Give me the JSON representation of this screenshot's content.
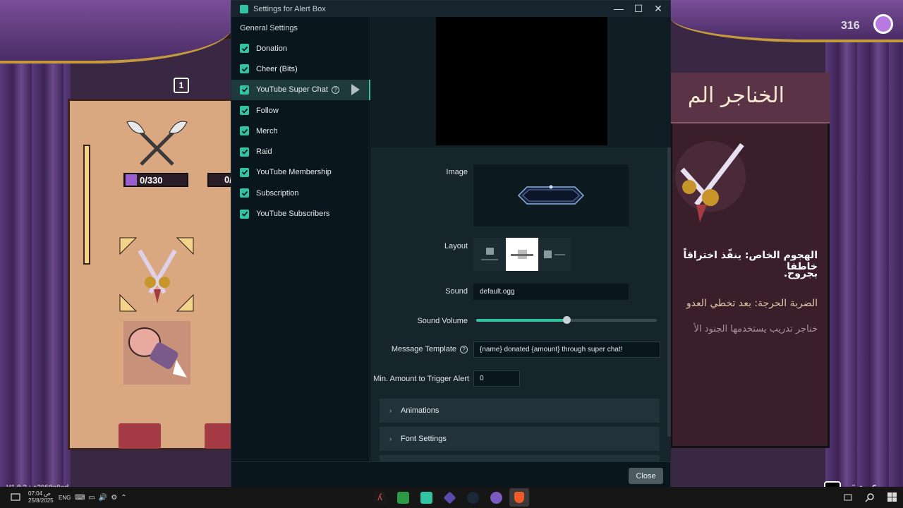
{
  "window": {
    "title": "Settings for Alert Box",
    "controls": [
      "—",
      "☐",
      "✕"
    ]
  },
  "sidebar": {
    "heading": "General Settings",
    "items": [
      {
        "label": "Donation",
        "checked": true
      },
      {
        "label": "Cheer (Bits)",
        "checked": true
      },
      {
        "label": "YouTube Super Chat",
        "checked": true,
        "active": true
      },
      {
        "label": "Follow",
        "checked": true
      },
      {
        "label": "Merch",
        "checked": true
      },
      {
        "label": "Raid",
        "checked": true
      },
      {
        "label": "YouTube Membership",
        "checked": true
      },
      {
        "label": "Subscription",
        "checked": true
      },
      {
        "label": "YouTube Subscribers",
        "checked": true
      }
    ]
  },
  "settings": {
    "image_label": "Image",
    "layout_label": "Layout",
    "sound_label": "Sound",
    "sound_value": "default.ogg",
    "volume_label": "Sound Volume",
    "volume_value": 0.5,
    "message_template_label": "Message Template",
    "message_template_value": "{name} donated {amount} through super chat!",
    "min_amount_label": "Min. Amount to Trigger Alert",
    "min_amount_value": "0",
    "accordions": [
      "Animations",
      "Font Settings"
    ]
  },
  "footer": {
    "close_label": "Close"
  },
  "game": {
    "score": "316",
    "level": "1",
    "counter": "0/330",
    "counter2": "0/",
    "arabic_title": "الخناجر الم",
    "arabic_line1": "الهجوم الخاص: ينفّذ اختراقاً خاطفا",
    "arabic_line2": "بجروح.",
    "arabic_line3": "الضربة الحرجة: بعد تخطي العدو",
    "arabic_line4": "خناجر تدريب يستخدمها الجنود الأ",
    "version": "V1.0.2 : e2959a0ed",
    "back_label": "عودة",
    "esc_label": "ESC"
  },
  "taskbar": {
    "time": "07:04 ص",
    "date": "25/8/2025",
    "lang": "ENG"
  },
  "colors": {
    "accent": "#31c3a2",
    "window_bg": "#09161d",
    "panel_bg": "#16252c"
  }
}
